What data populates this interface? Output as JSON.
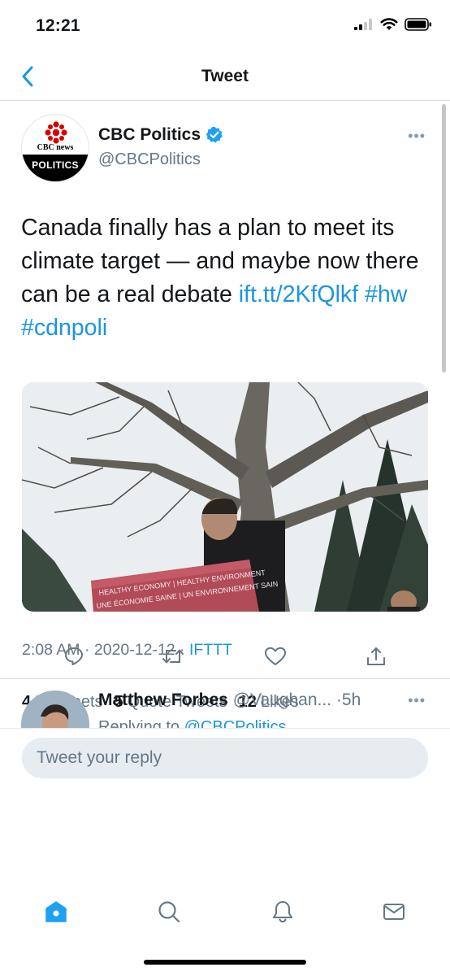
{
  "status_bar": {
    "time": "12:21"
  },
  "nav": {
    "title": "Tweet"
  },
  "tweet": {
    "author": {
      "name": "CBC Politics",
      "handle": "@CBCPolitics",
      "logo_text_top": "CBC news",
      "logo_text_band": "POLITICS"
    },
    "text": {
      "body": "Canada finally has a plan to meet its climate target — and maybe now there can be a real debate ",
      "link": "ift.tt/2KfQlkf",
      "hashtag1": "#hw",
      "hashtag2": "#cdnpoli"
    },
    "media": {
      "podium_line1": "HEALTHY ECONOMY | HEALTHY ENVIRONMENT",
      "podium_line2": "UNE ÉCONOMIE SAINE | UN ENVIRONNEMENT SAIN"
    },
    "meta": {
      "time": "2:08 AM",
      "date": "2020-12-12",
      "source": "IFTTT"
    },
    "stats": {
      "retweets_count": "4",
      "retweets_label": "Retweets",
      "quotes_count": "5",
      "quotes_label": "Quote Tweets",
      "likes_count": "12",
      "likes_label": "Likes"
    }
  },
  "reply": {
    "name": "Matthew Forbes",
    "handle": "@Vaughan...",
    "time": "·5h",
    "replying_prefix": "Replying to ",
    "replying_to": "@CBCPolitics"
  },
  "composer": {
    "placeholder": "Tweet your reply"
  },
  "colors": {
    "accent": "#1b95e0",
    "secondary_text": "#657786",
    "cbc_red": "#d50000"
  }
}
